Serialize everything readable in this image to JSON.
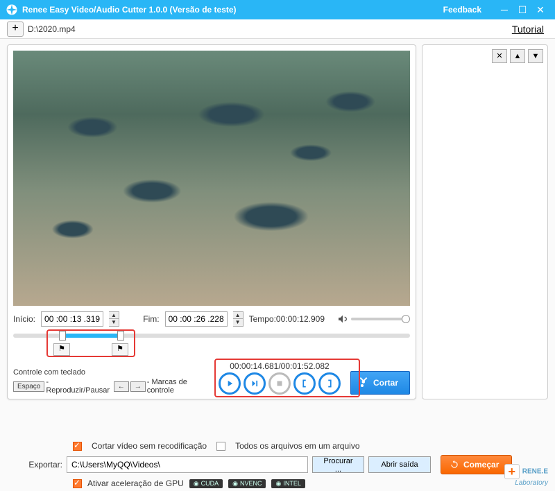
{
  "titlebar": {
    "title": "Renee Easy Video/Audio Cutter 1.0.0 (Versão de teste)",
    "feedback": "Feedback"
  },
  "toolbar": {
    "filepath": "D:\\2020.mp4",
    "tutorial": "Tutorial"
  },
  "time": {
    "start_label": "Início:",
    "start_value": "00 :00 :13 .319",
    "end_label": "Fim:",
    "end_value": "00 :00 :26 .228",
    "tempo_label": "Tempo:",
    "tempo_value": "00:00:12.909"
  },
  "keyboard": {
    "title": "Controle com teclado",
    "space": "Espaço",
    "play_pause": "- Reproduzir/Pausar",
    "left": "←",
    "right": "→",
    "marks": "- Marcas de controle"
  },
  "playback": {
    "pos": "00:00:14.681",
    "dur": "00:01:52.082",
    "sep": "/"
  },
  "cut_label": "Cortar",
  "options": {
    "recut": "Cortar vídeo sem recodificação",
    "allone": "Todos os arquivos em um arquivo"
  },
  "export": {
    "label": "Exportar:",
    "path": "C:\\Users\\MyQQ\\Videos\\",
    "browse": "Procurar ...",
    "open": "Abrir saída"
  },
  "start_label": "Começar",
  "gpu": {
    "label": "Ativar aceleração de GPU",
    "cuda": "CUDA",
    "nvenc": "NVENC",
    "intel": "INTEL"
  },
  "logo": {
    "brand": "RENE.E",
    "sub": "Laboratory"
  }
}
